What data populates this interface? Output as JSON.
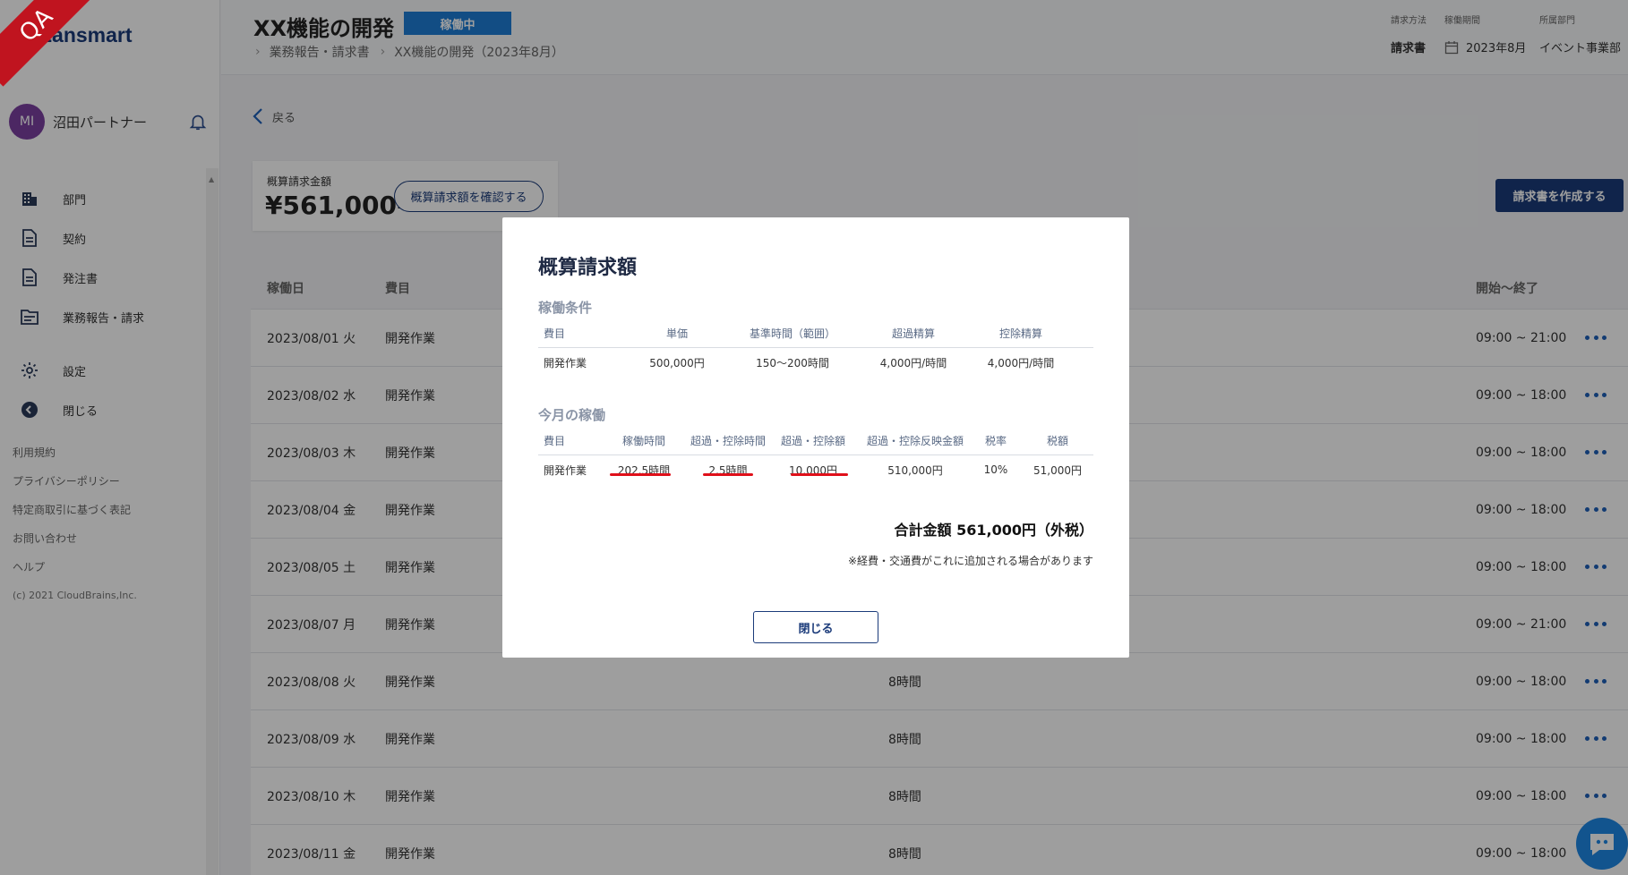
{
  "app": {
    "logo": "Lansmart",
    "qa_badge": "QA"
  },
  "user": {
    "initials": "MI",
    "name": "沼田パートナー"
  },
  "nav": [
    {
      "label": "部門",
      "icon": "building-icon"
    },
    {
      "label": "契約",
      "icon": "document-icon"
    },
    {
      "label": "発注書",
      "icon": "document-icon"
    },
    {
      "label": "業務報告・請求",
      "icon": "folder-icon"
    },
    {
      "label": "設定",
      "icon": "gear-icon"
    },
    {
      "label": "閉じる",
      "icon": "collapse-icon"
    }
  ],
  "footer_links": [
    "利用規約",
    "プライバシーポリシー",
    "特定商取引に基づく表記",
    "お問い合わせ",
    "ヘルプ"
  ],
  "copyright": "(c) 2021 CloudBrains,Inc.",
  "header": {
    "title": "XX機能の開発",
    "status": "稼働中",
    "breadcrumb": [
      "業務報告・請求書",
      "XX機能の開発（2023年8月）"
    ],
    "meta": {
      "billing_method_label": "請求方法",
      "billing_method_value": "請求書",
      "period_label": "稼働期間",
      "period_value": "2023年8月",
      "department_label": "所属部門",
      "department_value": "イベント事業部"
    }
  },
  "main": {
    "back_label": "戻る",
    "summary_label": "概算請求金額",
    "summary_amount": "¥561,000-",
    "confirm_button": "概算請求額を確認する",
    "create_button": "請求書を作成する",
    "table_headers": {
      "date": "稼働日",
      "item": "費目",
      "time": "開始～終了"
    },
    "rows": [
      {
        "date": "2023/08/01 火",
        "item": "開発作業",
        "hours": "",
        "time": "09:00 ~ 21:00"
      },
      {
        "date": "2023/08/02 水",
        "item": "開発作業",
        "hours": "",
        "time": "09:00 ~ 18:00"
      },
      {
        "date": "2023/08/03 木",
        "item": "開発作業",
        "hours": "",
        "time": "09:00 ~ 18:00"
      },
      {
        "date": "2023/08/04 金",
        "item": "開発作業",
        "hours": "",
        "time": "09:00 ~ 18:00"
      },
      {
        "date": "2023/08/05 土",
        "item": "開発作業",
        "hours": "",
        "time": "09:00 ~ 18:00"
      },
      {
        "date": "2023/08/07 月",
        "item": "開発作業",
        "hours": "",
        "time": "09:00 ~ 21:00"
      },
      {
        "date": "2023/08/08 火",
        "item": "開発作業",
        "hours": "8時間",
        "time": "09:00 ~ 18:00"
      },
      {
        "date": "2023/08/09 水",
        "item": "開発作業",
        "hours": "8時間",
        "time": "09:00 ~ 18:00"
      },
      {
        "date": "2023/08/10 木",
        "item": "開発作業",
        "hours": "8時間",
        "time": "09:00 ~ 18:00"
      },
      {
        "date": "2023/08/11 金",
        "item": "開発作業",
        "hours": "8時間",
        "time": "09:00 ~ 18:00"
      }
    ]
  },
  "modal": {
    "title": "概算請求額",
    "conditions_title": "稼働条件",
    "conditions_headers": [
      "費目",
      "単価",
      "基準時間（範囲）",
      "超過精算",
      "控除精算"
    ],
    "conditions_row": [
      "開発作業",
      "500,000円",
      "150〜200時間",
      "4,000円/時間",
      "4,000円/時間"
    ],
    "month_title": "今月の稼働",
    "month_headers": [
      "費目",
      "稼働時間",
      "超過・控除時間",
      "超過・控除額",
      "超過・控除反映金額",
      "税率",
      "税額"
    ],
    "month_row": [
      "開発作業",
      "202.5時間",
      "2.5時間",
      "10,000円",
      "510,000円",
      "10%",
      "51,000円"
    ],
    "total": "合計金額  561,000円（外税）",
    "note": "※経費・交通費がこれに追加される場合があります",
    "close_button": "閉じる"
  },
  "colors": {
    "brand": "#1b3b7a",
    "status": "#1e7dd6",
    "highlight_underline": "#e0101a",
    "qa_ribbon": "#c0141f"
  }
}
